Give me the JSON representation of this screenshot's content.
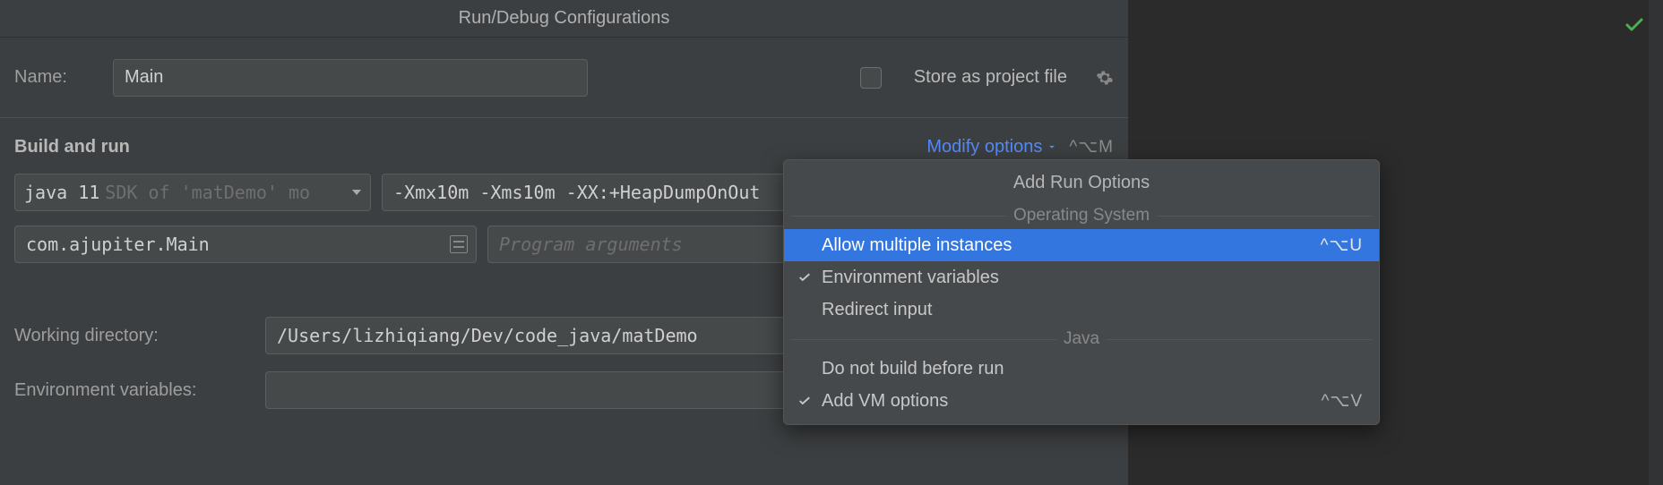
{
  "dialog": {
    "title": "Run/Debug Configurations",
    "name_label": "Name:",
    "name_value": "Main",
    "store_as_project_label": "Store as project file"
  },
  "build_run": {
    "section_title": "Build and run",
    "modify_options_label": "Modify options",
    "modify_shortcut": "^⌥M",
    "jdk_value": "java 11",
    "jdk_hint": "SDK of 'matDemo' mo",
    "vm_options": "-Xmx10m -Xms10m -XX:+HeapDumpOnOut",
    "main_class": "com.ajupiter.Main",
    "program_args_placeholder": "Program arguments",
    "working_dir_label": "Working directory:",
    "working_dir_value": "/Users/lizhiqiang/Dev/code_java/matDemo",
    "env_vars_label": "Environment variables:"
  },
  "popup": {
    "title": "Add Run Options",
    "group_os": "Operating System",
    "group_java": "Java",
    "items": {
      "allow_multiple": {
        "label": "Allow multiple instances",
        "shortcut": "^⌥U"
      },
      "env_vars": {
        "label": "Environment variables"
      },
      "redirect_input": {
        "label": "Redirect input"
      },
      "no_build": {
        "label": "Do not build before run"
      },
      "add_vm": {
        "label": "Add VM options",
        "shortcut": "^⌥V"
      }
    }
  }
}
